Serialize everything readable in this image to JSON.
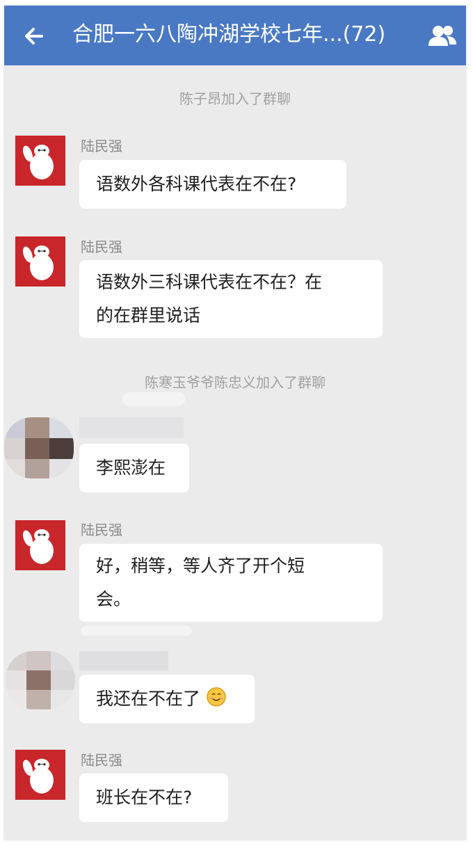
{
  "header": {
    "title": "合肥一六八陶冲湖学校七年...(72)",
    "back_icon": "arrow-left-icon",
    "members_icon": "group-members-icon",
    "color": "#4a79c4"
  },
  "messages": {
    "sys1": "陈子昂加入了群聊",
    "m1": {
      "sender": "陆民强",
      "text": "语数外各科课代表在不在?"
    },
    "m2": {
      "sender": "陆民强",
      "text_line1": "语数外三科课代表在不在？在",
      "text_line2": "的在群里说话"
    },
    "sys2": "陈寒玉爷爷陈忠义加入了群聊",
    "m3": {
      "text": "李熙澎在"
    },
    "m4": {
      "sender": "陆民强",
      "text_line1": "好，稍等，等人齐了开个短",
      "text_line2": "会。"
    },
    "m5": {
      "text": "我还在不在了",
      "emoji": "smile-emoji-icon"
    },
    "m6": {
      "sender": "陆民强",
      "text": "班长在不在?"
    }
  }
}
